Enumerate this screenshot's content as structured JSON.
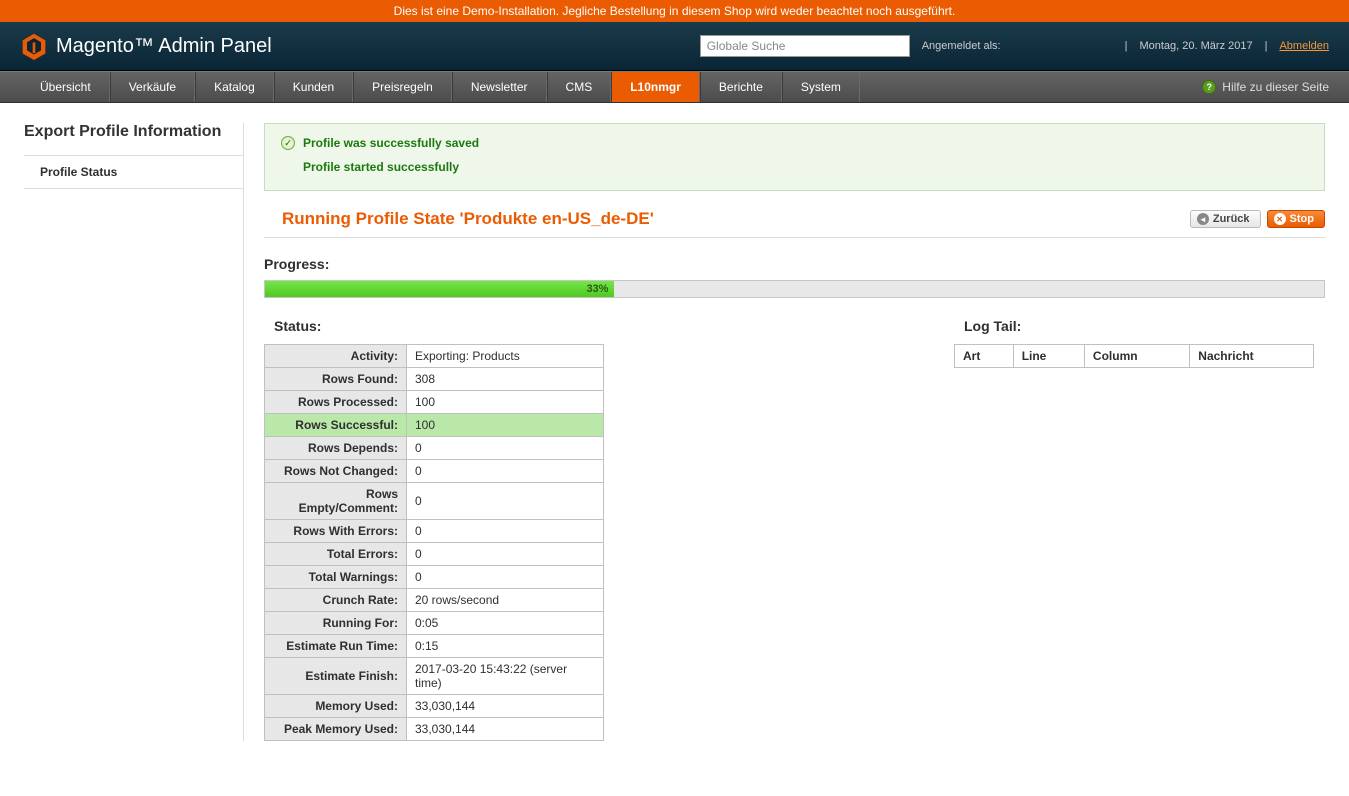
{
  "demo_banner": "Dies ist eine Demo-Installation. Jegliche Bestellung in diesem Shop wird weder beachtet noch ausgeführt.",
  "logo": {
    "brand": "Magento",
    "suffix": "Admin Panel"
  },
  "header": {
    "search_placeholder": "Globale Suche",
    "logged_in_label": "Angemeldet als:",
    "date": "Montag, 20. März 2017",
    "logout": "Abmelden"
  },
  "menu": {
    "items": [
      "Übersicht",
      "Verkäufe",
      "Katalog",
      "Kunden",
      "Preisregeln",
      "Newsletter",
      "CMS",
      "L10nmgr",
      "Berichte",
      "System"
    ],
    "active_index": 7,
    "help": "Hilfe zu dieser Seite"
  },
  "sidebar": {
    "heading": "Export Profile Information",
    "items": [
      "Profile Status"
    ]
  },
  "messages": {
    "saved": "Profile was successfully saved",
    "started": "Profile started successfully"
  },
  "title": "Running Profile State 'Produkte en-US_de-DE'",
  "buttons": {
    "back": "Zurück",
    "stop": "Stop"
  },
  "progress": {
    "label": "Progress:",
    "percent_text": "33%",
    "percent": 33
  },
  "status": {
    "label": "Status:",
    "rows": [
      {
        "k": "Activity:",
        "v": "Exporting: Products"
      },
      {
        "k": "Rows Found:",
        "v": "308"
      },
      {
        "k": "Rows Processed:",
        "v": "100"
      },
      {
        "k": "Rows Successful:",
        "v": "100",
        "highlight": true
      },
      {
        "k": "Rows Depends:",
        "v": "0"
      },
      {
        "k": "Rows Not Changed:",
        "v": "0"
      },
      {
        "k": "Rows Empty/Comment:",
        "v": "0"
      },
      {
        "k": "Rows With Errors:",
        "v": "0"
      },
      {
        "k": "Total Errors:",
        "v": "0"
      },
      {
        "k": "Total Warnings:",
        "v": "0"
      },
      {
        "k": "Crunch Rate:",
        "v": "20 rows/second"
      },
      {
        "k": "Running For:",
        "v": "0:05"
      },
      {
        "k": "Estimate Run Time:",
        "v": "0:15"
      },
      {
        "k": "Estimate Finish:",
        "v": "2017-03-20 15:43:22 (server time)"
      },
      {
        "k": "Memory Used:",
        "v": "33,030,144"
      },
      {
        "k": "Peak Memory Used:",
        "v": "33,030,144"
      }
    ]
  },
  "log": {
    "label": "Log Tail:",
    "columns": [
      "Art",
      "Line",
      "Column",
      "Nachricht"
    ]
  }
}
